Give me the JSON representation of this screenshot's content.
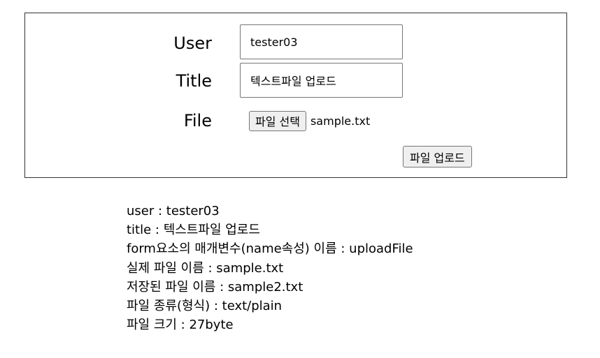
{
  "form": {
    "user_label": "User",
    "user_value": "tester03",
    "title_label": "Title",
    "title_value": "텍스트파일 업로드",
    "file_label": "File",
    "file_button_label": "파일 선택",
    "file_name": "sample.txt",
    "upload_button_label": "파일 업로드"
  },
  "result": {
    "lines": [
      "user : tester03",
      "title : 텍스트파일 업로드",
      "form요소의 매개변수(name속성) 이름 : uploadFile",
      "실제 파일 이름 : sample.txt",
      "저장된 파일 이름 : sample2.txt",
      "파일 종류(형식) : text/plain",
      "파일 크기 : 27byte"
    ]
  }
}
